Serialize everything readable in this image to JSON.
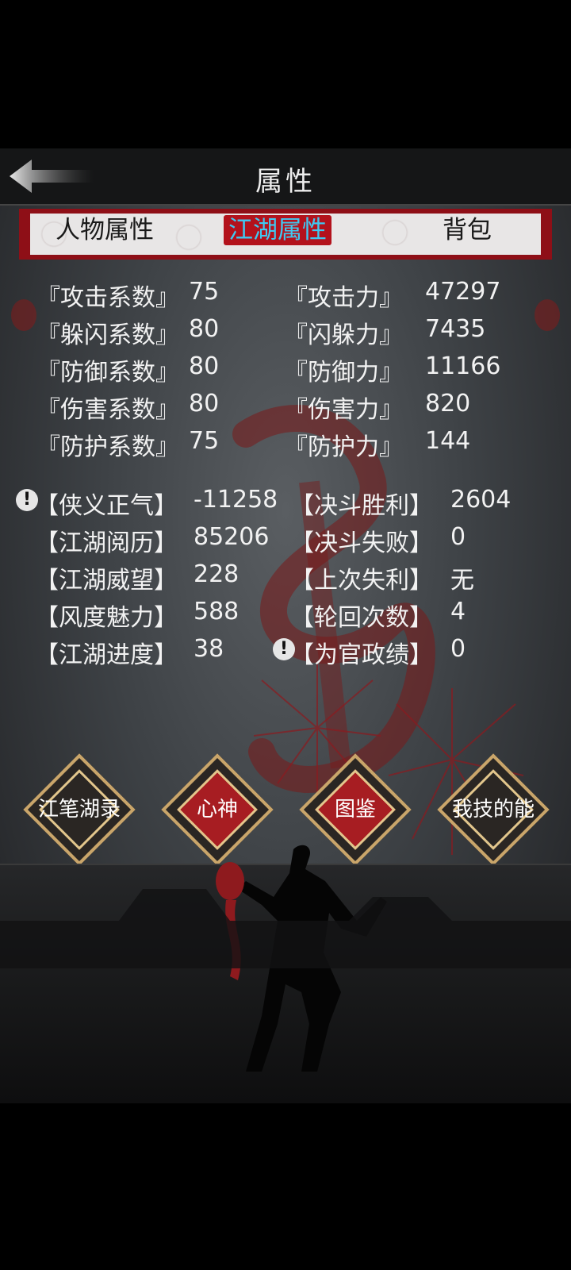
{
  "title": "属性",
  "tabs": [
    "人物属性",
    "江湖属性",
    "背包"
  ],
  "active_tab": "江湖属性",
  "coefficients": [
    {
      "label": "『攻击系数』",
      "value": "75",
      "label2": "『攻击力』",
      "value2": "47297"
    },
    {
      "label": "『躲闪系数』",
      "value": "80",
      "label2": "『闪躲力』",
      "value2": "7435"
    },
    {
      "label": "『防御系数』",
      "value": "80",
      "label2": "『防御力』",
      "value2": "11166"
    },
    {
      "label": "『伤害系数』",
      "value": "80",
      "label2": "『伤害力』",
      "value2": "820"
    },
    {
      "label": "『防护系数』",
      "value": "75",
      "label2": "『防护力』",
      "value2": "144"
    }
  ],
  "jianghu": [
    {
      "label": "【侠义正气】",
      "value": "-11258",
      "label2": "【决斗胜利】",
      "value2": "2604"
    },
    {
      "label": "【江湖阅历】",
      "value": "85206",
      "label2": "【决斗失败】",
      "value2": "0"
    },
    {
      "label": "【江湖威望】",
      "value": "228",
      "label2": "【上次失利】",
      "value2": "无"
    },
    {
      "label": "【风度魅力】",
      "value": "588",
      "label2": "【轮回次数】",
      "value2": "4"
    },
    {
      "label": "【江湖进度】",
      "value": "38",
      "label2": "【为官政绩】",
      "value2": "0"
    }
  ],
  "alert_glyph": "!",
  "buttons": [
    {
      "lines": [
        "江笔",
        "湖录"
      ]
    },
    {
      "lines": [
        "心神"
      ]
    },
    {
      "lines": [
        "图鉴"
      ]
    },
    {
      "lines": [
        "我技",
        "的能"
      ]
    }
  ],
  "colors": {
    "accent_red": "#b3121c",
    "active_tab_text": "#3fc9f2",
    "gold": "#c9a56a"
  }
}
